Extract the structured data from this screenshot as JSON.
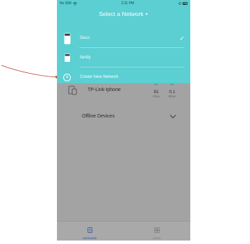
{
  "status_bar": {
    "carrier": "No SIM",
    "time": "2:11 PM"
  },
  "header": {
    "title": "Select a Network",
    "caret": "▼"
  },
  "networks": [
    {
      "label": "Deco",
      "selected": true,
      "check": "✓",
      "icon": "deco-unit-icon"
    },
    {
      "label": "family",
      "selected": false,
      "icon": "deco-unit-icon"
    }
  ],
  "create_network": {
    "label": "Create New Network",
    "icon": "plus-circle-icon",
    "symbol": "+"
  },
  "device": {
    "name": "TP-Link-Iphone",
    "download": {
      "value": "91",
      "unit": "Kbps"
    },
    "upload": {
      "value": "0.1",
      "unit": "Mbps"
    }
  },
  "offline": {
    "label": "Offline Devices"
  },
  "tab_bar": {
    "tabs": [
      {
        "label": "OVERVIEW",
        "active": true,
        "icon": "overview-icon"
      },
      {
        "label": "MORE",
        "active": false,
        "icon": "more-grid-icon"
      }
    ]
  },
  "colors": {
    "accent": "#5bcfd2",
    "overlay": "#a3a3a3",
    "annotation_arrow": "#c0392b"
  }
}
